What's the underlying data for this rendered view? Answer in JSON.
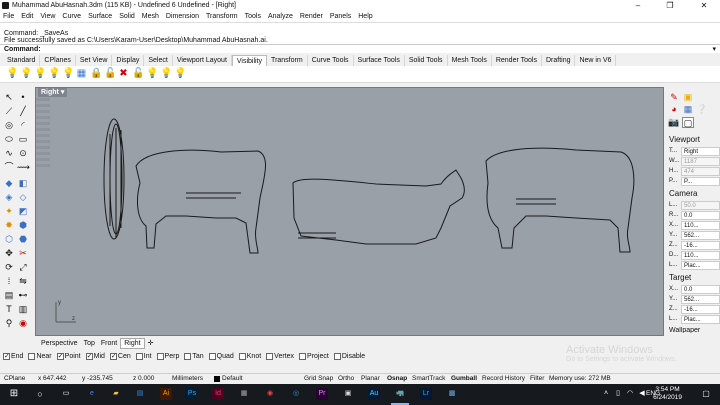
{
  "window": {
    "title": "Muhammad AbuHasnah.3dm (115 KB) - Undefined 6 Undefined - [Right]",
    "minimize": "–",
    "maximize": "❐",
    "close": "✕"
  },
  "menu": [
    "File",
    "Edit",
    "View",
    "Curve",
    "Surface",
    "Solid",
    "Mesh",
    "Dimension",
    "Transform",
    "Tools",
    "Analyze",
    "Render",
    "Panels",
    "Help"
  ],
  "command": {
    "history": [
      "Command: _SaveAs",
      "File successfully saved as C:\\Users\\Karam-User\\Desktop\\Muhammad AbuHasnah.ai."
    ],
    "prompt": "Command:"
  },
  "toolbar_tabs": [
    "Standard",
    "CPlanes",
    "Set View",
    "Display",
    "Select",
    "Viewport Layout",
    "Visibility",
    "Transform",
    "Curve Tools",
    "Surface Tools",
    "Solid Tools",
    "Mesh Tools",
    "Render Tools",
    "Drafting",
    "New in V6"
  ],
  "toolbar_tabs_active": "Visibility",
  "viewport": {
    "title": "Right",
    "axis_y": "y",
    "axis_z": "z"
  },
  "viewport_tabs": [
    "Perspective",
    "Top",
    "Front",
    "Right"
  ],
  "viewport_tabs_active": "Right",
  "properties": {
    "viewport_header": "Viewport",
    "viewport_rows": [
      {
        "k": "T...",
        "v": "Right",
        "disabled": false
      },
      {
        "k": "W...",
        "v": "1187",
        "disabled": true
      },
      {
        "k": "H...",
        "v": "474",
        "disabled": true
      },
      {
        "k": "P...",
        "v": "P...",
        "disabled": false
      }
    ],
    "camera_header": "Camera",
    "camera_rows": [
      {
        "k": "L...",
        "v": "50.0",
        "disabled": true
      },
      {
        "k": "R...",
        "v": "0.0",
        "disabled": false
      },
      {
        "k": "X...",
        "v": "110...",
        "disabled": false
      },
      {
        "k": "Y...",
        "v": "562...",
        "disabled": false
      },
      {
        "k": "Z...",
        "v": "-16...",
        "disabled": false
      },
      {
        "k": "D...",
        "v": "110...",
        "disabled": false
      },
      {
        "k": "L...",
        "v": "Plac...",
        "disabled": false
      }
    ],
    "target_header": "Target",
    "target_rows": [
      {
        "k": "X...",
        "v": "0.0",
        "disabled": false
      },
      {
        "k": "Y...",
        "v": "562...",
        "disabled": false
      },
      {
        "k": "Z...",
        "v": "-16...",
        "disabled": false
      },
      {
        "k": "L...",
        "v": "Plac...",
        "disabled": false
      }
    ],
    "wallpaper_header": "Wallpaper"
  },
  "osnap": [
    {
      "label": "End",
      "checked": true
    },
    {
      "label": "Near",
      "checked": false
    },
    {
      "label": "Point",
      "checked": true
    },
    {
      "label": "Mid",
      "checked": true
    },
    {
      "label": "Cen",
      "checked": true
    },
    {
      "label": "Int",
      "checked": false
    },
    {
      "label": "Perp",
      "checked": false
    },
    {
      "label": "Tan",
      "checked": false
    },
    {
      "label": "Quad",
      "checked": false
    },
    {
      "label": "Knot",
      "checked": false
    },
    {
      "label": "Vertex",
      "checked": false
    },
    {
      "label": "Project",
      "checked": false
    },
    {
      "label": "Disable",
      "checked": false
    }
  ],
  "activate": {
    "title": "Activate Windows",
    "subtitle": "Go to Settings to activate Windows."
  },
  "status": {
    "cplane": "CPlane",
    "x": "x 647.442",
    "y": "y -235.745",
    "z": "z 0.000",
    "units": "Millimeters",
    "layer": "Default",
    "grid_snap": "Grid Snap",
    "ortho": "Ortho",
    "planar": "Planar",
    "osnap": "Osnap",
    "smarttrack": "SmartTrack",
    "gumball": "Gumball",
    "record_history": "Record History",
    "filter": "Filter",
    "memory": "Memory use: 272 MB"
  },
  "taskbar": {
    "time": "3:54 PM",
    "date": "6/24/2019",
    "lang": "ENG"
  },
  "colors": {
    "viewport_bg": "#9aa0a8",
    "taskbar": "#16191d",
    "curve": "#1a1a1a"
  }
}
